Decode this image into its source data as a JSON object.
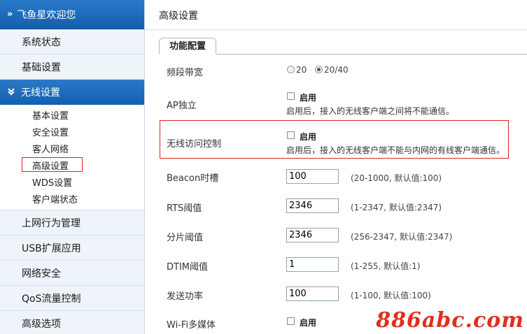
{
  "sidebar": {
    "header": "飞鱼星欢迎您",
    "header_chevron": "»",
    "items_top": [
      "系统状态",
      "基础设置"
    ],
    "group_open": {
      "label": "无线设置",
      "chevron": "⌄"
    },
    "sub_items": [
      "基本设置",
      "安全设置",
      "客人网络",
      "高级设置",
      "WDS设置",
      "客户端状态"
    ],
    "active_sub": "高级设置",
    "items_bottom": [
      "上网行为管理",
      "USB扩展应用",
      "网络安全",
      "QoS流量控制",
      "高级选项"
    ]
  },
  "main": {
    "title": "高级设置",
    "tab": "功能配置",
    "bandwidth": {
      "label": "频段带宽",
      "options": [
        "20",
        "20/40"
      ],
      "selected": "20/40"
    },
    "ap_isolation": {
      "label": "AP独立",
      "checkbox_label": "启用",
      "checked": false,
      "desc": "启用后，接入的无线客户端之间将不能通信。"
    },
    "wireless_access_control": {
      "label": "无线访问控制",
      "checkbox_label": "启用",
      "checked": false,
      "desc": "启用后，接入的无线客户端不能与内网的有线客户端通信。"
    },
    "beacon": {
      "label": "Beacon时槽",
      "value": "100",
      "hint": "(20-1000, 默认值:100)"
    },
    "rts": {
      "label": "RTS阈值",
      "value": "2346",
      "hint": "(1-2347, 默认值:2347)"
    },
    "frag": {
      "label": "分片阈值",
      "value": "2346",
      "hint": "(256-2347, 默认值:2347)"
    },
    "dtim": {
      "label": "DTIM阈值",
      "value": "1",
      "hint": "(1-255, 默认值:1)"
    },
    "tx_power": {
      "label": "发送功率",
      "value": "100",
      "hint": "(1-100, 默认值:100)"
    },
    "wmm": {
      "label": "Wi-Fi多媒体",
      "checkbox_label": "启用",
      "checked": false
    }
  },
  "watermark": "886abc.com",
  "colors": {
    "accent": "#145fae",
    "highlight": "#e02020",
    "watermark": "#e0301e"
  }
}
